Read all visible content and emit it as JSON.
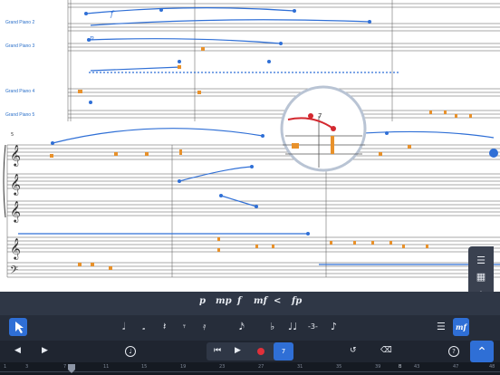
{
  "score": {
    "instrument_labels": [
      "Grand Piano 2",
      "Grand Piano 3",
      "Grand Piano 4",
      "Grand Piano 5"
    ],
    "system_number": "5",
    "zoom_loupe_number": "7",
    "dynamic_mark_1": "f",
    "dynamic_mark_2": "p"
  },
  "dynamics_palette": {
    "items": [
      "p",
      "mp",
      "f",
      "mf",
      "<",
      "fp"
    ]
  },
  "note_toolbar": {
    "select_icon": "cursor-arrow-icon",
    "items": [
      "𝅗𝅥",
      "𝅗",
      "𝄽",
      "𝄾",
      "𝄿",
      "𝅘𝅥𝅯",
      "♭",
      "♩♩",
      "-3-",
      "♪"
    ],
    "mf_label": "mf"
  },
  "transport": {
    "tempo_label": "♩",
    "record_color": "#e0303a",
    "active_color": "#2f6fd6",
    "step_value": "7",
    "help_label": "?"
  },
  "timeline": {
    "ticks": [
      "1",
      "3",
      "7",
      "11",
      "15",
      "19",
      "23",
      "27",
      "31",
      "35",
      "39",
      "43",
      "B",
      "47",
      "48"
    ]
  },
  "colors": {
    "accent": "#2f6fd6",
    "note_orange": "#e8912b",
    "loupe_red": "#d3282f"
  }
}
